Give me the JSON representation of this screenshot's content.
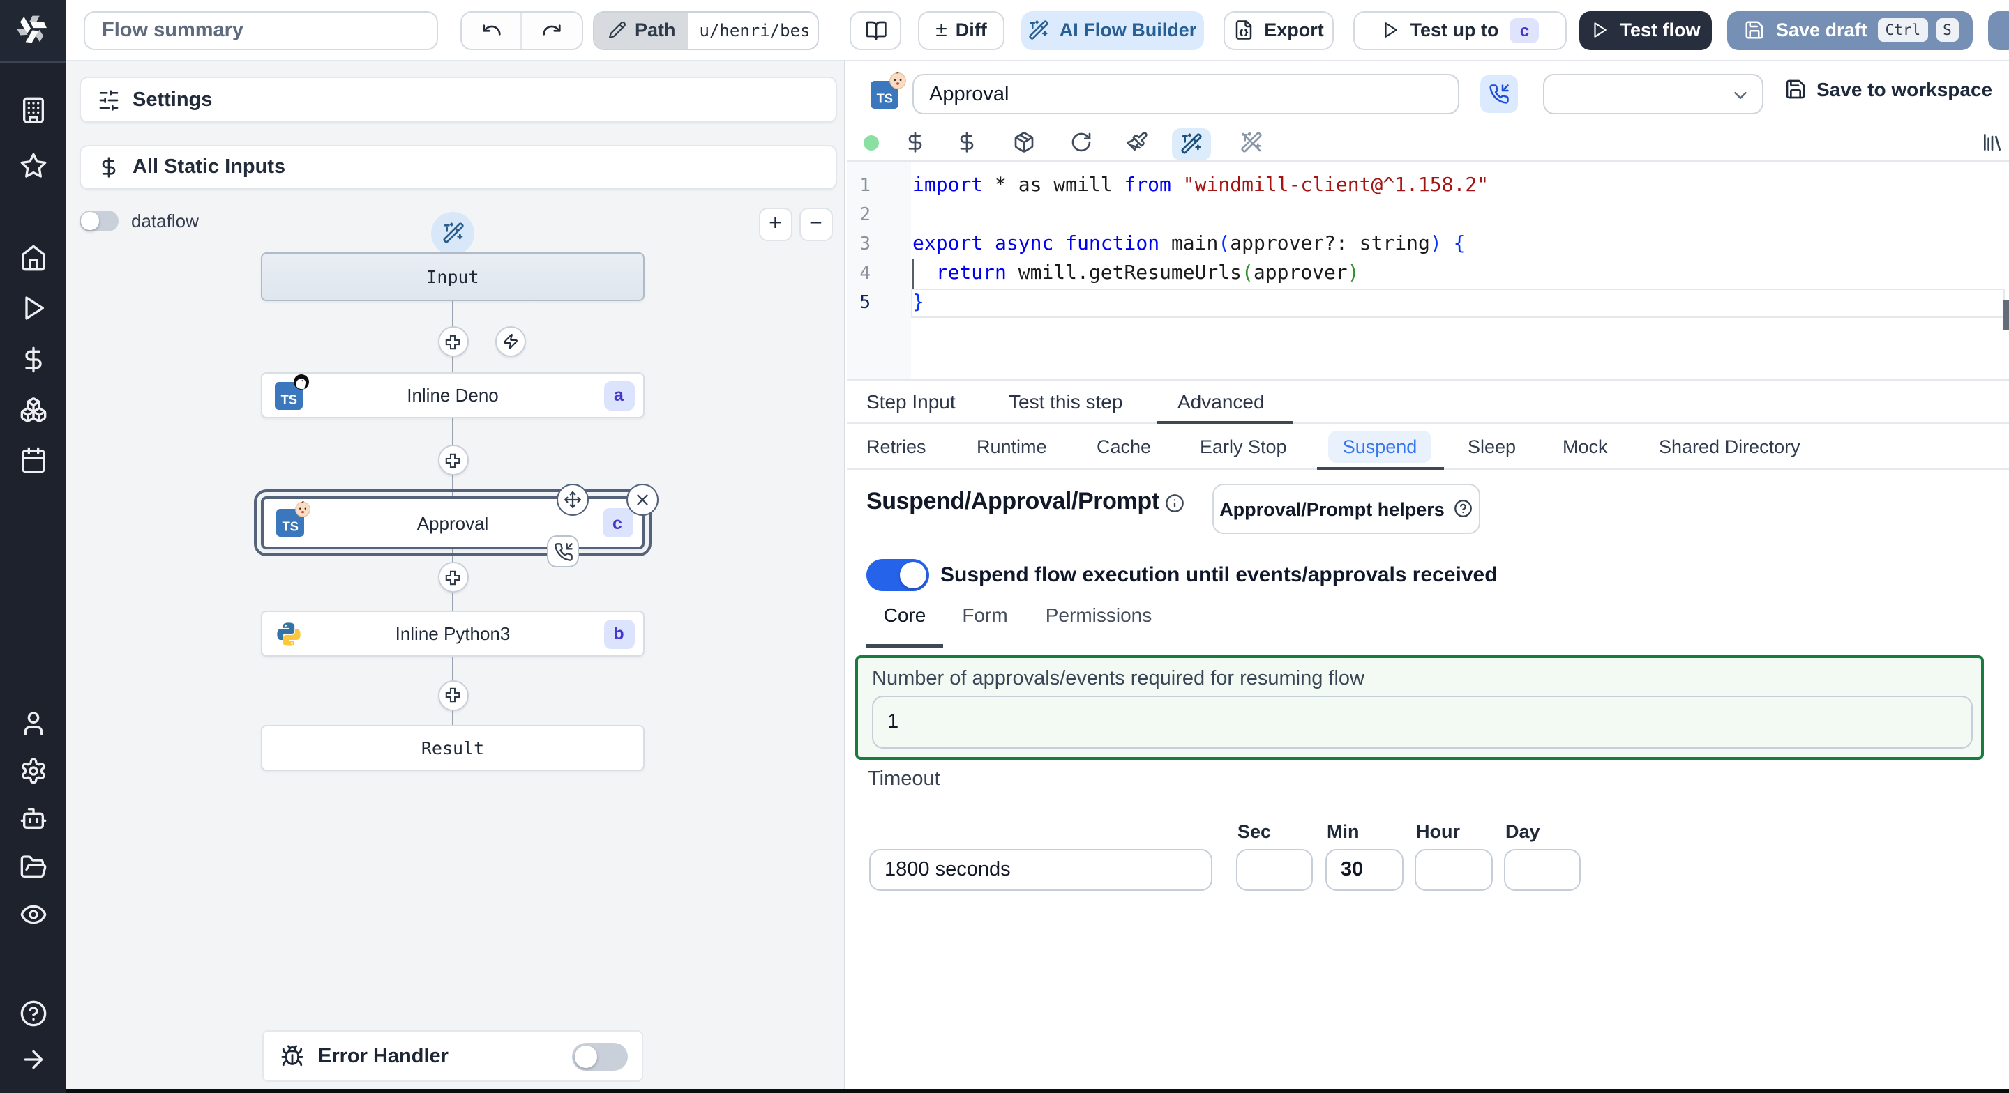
{
  "topbar": {
    "flow_summary": "Flow summary",
    "path_label": "Path",
    "path_value": "u/henri/bes",
    "diff_label": "Diff",
    "diff_glyph": "±",
    "ai_flow_builder_label": "AI Flow Builder",
    "export_label": "Export",
    "test_up_to_label": "Test up to",
    "test_up_to_badge": "c",
    "test_flow_label": "Test flow",
    "save_draft_label": "Save draft",
    "kbd_ctrl": "Ctrl",
    "kbd_s": "S"
  },
  "flow_panel": {
    "settings_label": "Settings",
    "static_inputs_label": "All Static Inputs",
    "dataflow_label": "dataflow",
    "zoom_in_glyph": "+",
    "zoom_out_glyph": "−",
    "nodes": {
      "input_label": "Input",
      "deno_label": "Inline Deno",
      "deno_badge": "a",
      "approval_label": "Approval",
      "approval_badge": "c",
      "python_label": "Inline Python3",
      "python_badge": "b",
      "result_label": "Result"
    },
    "error_handler_label": "Error Handler"
  },
  "step_editor": {
    "name_value": "Approval",
    "save_to_workspace_label": "Save to workspace",
    "line_numbers": [
      "1",
      "2",
      "3",
      "4",
      "5"
    ],
    "code": {
      "l1": [
        {
          "t": "import",
          "c": "tok-kw"
        },
        {
          "t": " * as wmill ",
          "c": ""
        },
        {
          "t": "from",
          "c": "tok-kw"
        },
        {
          "t": " ",
          "c": ""
        },
        {
          "t": "\"windmill-client@^1.158.2\"",
          "c": "tok-str"
        }
      ],
      "l3": [
        {
          "t": "export",
          "c": "tok-kw"
        },
        {
          "t": " ",
          "c": ""
        },
        {
          "t": "async",
          "c": "tok-kw"
        },
        {
          "t": " ",
          "c": ""
        },
        {
          "t": "function",
          "c": "tok-kw"
        },
        {
          "t": " main",
          "c": ""
        },
        {
          "t": "(",
          "c": "tok-b0"
        },
        {
          "t": "approver?: string",
          "c": ""
        },
        {
          "t": ")",
          "c": "tok-b0"
        },
        {
          "t": " ",
          "c": ""
        },
        {
          "t": "{",
          "c": "tok-b0"
        }
      ],
      "l4": [
        {
          "t": "  ",
          "c": ""
        },
        {
          "t": "return",
          "c": "tok-kw"
        },
        {
          "t": " wmill.getResumeUrls",
          "c": ""
        },
        {
          "t": "(",
          "c": "tok-b1"
        },
        {
          "t": "approver",
          "c": ""
        },
        {
          "t": ")",
          "c": "tok-b1"
        }
      ],
      "l5": [
        {
          "t": "}",
          "c": "tok-b0"
        }
      ]
    }
  },
  "tabs": {
    "step_input": "Step Input",
    "test_this_step": "Test this step",
    "advanced": "Advanced"
  },
  "subtabs": {
    "retries": "Retries",
    "runtime": "Runtime",
    "cache": "Cache",
    "early_stop": "Early Stop",
    "suspend": "Suspend",
    "sleep": "Sleep",
    "mock": "Mock",
    "shared_directory": "Shared Directory"
  },
  "suspend_section": {
    "title": "Suspend/Approval/Prompt",
    "helpers_button_label": "Approval/Prompt helpers",
    "toggle_label": "Suspend flow execution until events/approvals received",
    "tab_core": "Core",
    "tab_form": "Form",
    "tab_permissions": "Permissions",
    "approvals_label": "Number of approvals/events required for resuming flow",
    "approvals_value": "1",
    "timeout_label": "Timeout",
    "timeout_value": "1800 seconds",
    "sec_label": "Sec",
    "min_label": "Min",
    "hour_label": "Hour",
    "day_label": "Day",
    "sec_value": "",
    "min_value": "30",
    "hour_value": "",
    "day_value": ""
  },
  "icons": {
    "ts_label": "TS"
  },
  "colors": {
    "accent_blue": "#2563eb",
    "save_draft_bg": "#7590b4",
    "test_flow_bg": "#272e3d",
    "badge_bg": "#dce3fc",
    "badge_text": "#4338ca",
    "green_border": "#177c3d",
    "sidebar_bg": "#1e222d"
  }
}
